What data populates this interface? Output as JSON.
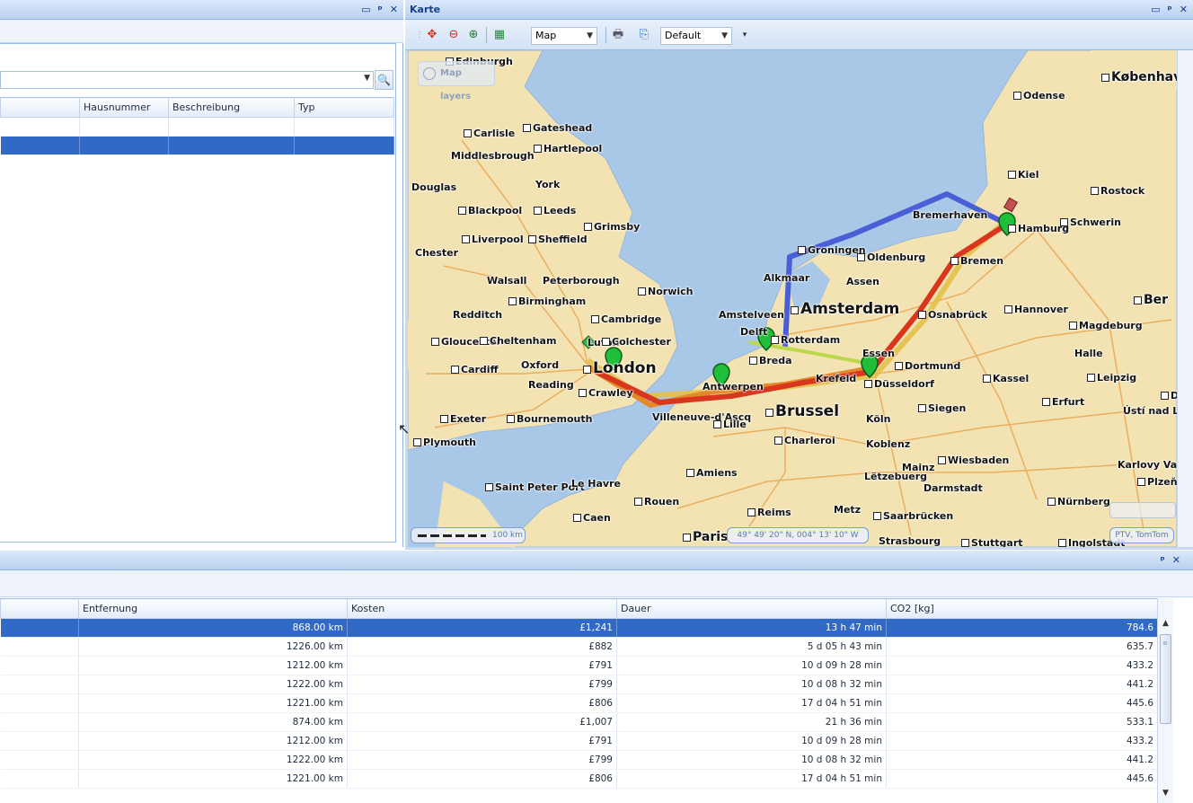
{
  "left_panel": {
    "window_buttons": [
      "▭",
      "ᵖ",
      "✕"
    ],
    "combo_value": "",
    "columns": [
      "",
      "Hausnummer",
      "Beschreibung",
      "Typ"
    ]
  },
  "map_panel": {
    "title": "Karte",
    "window_buttons": [
      "▭",
      "ᵖ",
      "✕"
    ],
    "toolbar": {
      "map_type_value": "Map",
      "profile_value": "Default"
    },
    "map_layers_label": "Map layers",
    "scale_label": "100 km",
    "coordinates": "49° 49' 20\" N, 004° 13' 10\" W",
    "copyright": "PTV, TomTom",
    "cities": [
      {
        "name": "Edinburgh",
        "size": "small"
      },
      {
        "name": "København",
        "size": "mid"
      },
      {
        "name": "Odense",
        "size": "small"
      },
      {
        "name": "Carlisle",
        "size": "small"
      },
      {
        "name": "Gateshead",
        "size": "small"
      },
      {
        "name": "Hartlepool",
        "size": "small"
      },
      {
        "name": "Middlesbrough",
        "size": "small"
      },
      {
        "name": "Kiel",
        "size": "small"
      },
      {
        "name": "Rostock",
        "size": "small"
      },
      {
        "name": "Douglas",
        "size": "small"
      },
      {
        "name": "York",
        "size": "small"
      },
      {
        "name": "Blackpool",
        "size": "small"
      },
      {
        "name": "Leeds",
        "size": "small"
      },
      {
        "name": "Bremerhaven",
        "size": "small"
      },
      {
        "name": "Grimsby",
        "size": "small"
      },
      {
        "name": "Hamburg",
        "size": "small"
      },
      {
        "name": "Schwerin",
        "size": "small"
      },
      {
        "name": "Liverpool",
        "size": "small"
      },
      {
        "name": "Sheffield",
        "size": "small"
      },
      {
        "name": "Chester",
        "size": "small"
      },
      {
        "name": "Groningen",
        "size": "small"
      },
      {
        "name": "Oldenburg",
        "size": "small"
      },
      {
        "name": "Bremen",
        "size": "small"
      },
      {
        "name": "Walsall",
        "size": "small"
      },
      {
        "name": "Peterborough",
        "size": "small"
      },
      {
        "name": "Alkmaar",
        "size": "small"
      },
      {
        "name": "Assen",
        "size": "small"
      },
      {
        "name": "Norwich",
        "size": "small"
      },
      {
        "name": "Birmingham",
        "size": "small"
      },
      {
        "name": "Ber",
        "size": "mid"
      },
      {
        "name": "Redditch",
        "size": "small"
      },
      {
        "name": "Cambridge",
        "size": "small"
      },
      {
        "name": "Amstelveen",
        "size": "small"
      },
      {
        "name": "Amsterdam",
        "size": "big"
      },
      {
        "name": "Osnabrück",
        "size": "small"
      },
      {
        "name": "Hannover",
        "size": "small"
      },
      {
        "name": "Magdeburg",
        "size": "small"
      },
      {
        "name": "Gloucester",
        "size": "small"
      },
      {
        "name": "Cheltenham",
        "size": "small"
      },
      {
        "name": "Luton",
        "size": "small"
      },
      {
        "name": "Colchester",
        "size": "small"
      },
      {
        "name": "Delft",
        "size": "small"
      },
      {
        "name": "Rotterdam",
        "size": "small"
      },
      {
        "name": "Essen",
        "size": "small"
      },
      {
        "name": "Halle",
        "size": "small"
      },
      {
        "name": "Oxford",
        "size": "small"
      },
      {
        "name": "London",
        "size": "big"
      },
      {
        "name": "Breda",
        "size": "small"
      },
      {
        "name": "Dortmund",
        "size": "small"
      },
      {
        "name": "Cardiff",
        "size": "small"
      },
      {
        "name": "Reading",
        "size": "small"
      },
      {
        "name": "Krefeld",
        "size": "small"
      },
      {
        "name": "Düsseldorf",
        "size": "small"
      },
      {
        "name": "Kassel",
        "size": "small"
      },
      {
        "name": "Leipzig",
        "size": "small"
      },
      {
        "name": "Crawley",
        "size": "small"
      },
      {
        "name": "Antwerpen",
        "size": "small"
      },
      {
        "name": "Erfurt",
        "size": "small"
      },
      {
        "name": "Dre",
        "size": "small"
      },
      {
        "name": "Brussel",
        "size": "big"
      },
      {
        "name": "Siegen",
        "size": "small"
      },
      {
        "name": "Exeter",
        "size": "small"
      },
      {
        "name": "Bournemouth",
        "size": "small"
      },
      {
        "name": "Villeneuve-d'Ascq",
        "size": "small"
      },
      {
        "name": "Lille",
        "size": "small"
      },
      {
        "name": "Köln",
        "size": "small"
      },
      {
        "name": "Ústí nad Labem",
        "size": "small"
      },
      {
        "name": "Plymouth",
        "size": "small"
      },
      {
        "name": "Charleroi",
        "size": "small"
      },
      {
        "name": "Koblenz",
        "size": "small"
      },
      {
        "name": "Wiesbaden",
        "size": "small"
      },
      {
        "name": "Mainz",
        "size": "small"
      },
      {
        "name": "Karlovy Vary",
        "size": "small"
      },
      {
        "name": "Amiens",
        "size": "small"
      },
      {
        "name": "Lëtzebuerg",
        "size": "small"
      },
      {
        "name": "Plzeň",
        "size": "small"
      },
      {
        "name": "Saint Peter Port",
        "size": "small"
      },
      {
        "name": "Le Havre",
        "size": "small"
      },
      {
        "name": "Darmstadt",
        "size": "small"
      },
      {
        "name": "Rouen",
        "size": "small"
      },
      {
        "name": "Nürnberg",
        "size": "small"
      },
      {
        "name": "Reims",
        "size": "small"
      },
      {
        "name": "Metz",
        "size": "small"
      },
      {
        "name": "Caen",
        "size": "small"
      },
      {
        "name": "Saarbrücken",
        "size": "small"
      },
      {
        "name": "Paris",
        "size": "mid"
      },
      {
        "name": "Strasbourg",
        "size": "small"
      },
      {
        "name": "Stuttgart",
        "size": "small"
      },
      {
        "name": "Ingolstadt",
        "size": "small"
      }
    ]
  },
  "bottom_panel": {
    "window_buttons": [
      "ᵖ",
      "✕"
    ],
    "columns": [
      "",
      "Entfernung",
      "Kosten",
      "Dauer",
      "CO2 [kg]"
    ],
    "rows": [
      {
        "distance": "868.00 km",
        "cost": "£1,241",
        "duration": "13 h 47 min",
        "co2": "784.6"
      },
      {
        "distance": "1226.00 km",
        "cost": "£882",
        "duration": "5 d 05 h 43 min",
        "co2": "635.7"
      },
      {
        "distance": "1212.00 km",
        "cost": "£791",
        "duration": "10 d 09 h 28 min",
        "co2": "433.2"
      },
      {
        "distance": "1222.00 km",
        "cost": "£799",
        "duration": "10 d 08 h 32 min",
        "co2": "441.2"
      },
      {
        "distance": "1221.00 km",
        "cost": "£806",
        "duration": "17 d 04 h 51 min",
        "co2": "445.6"
      },
      {
        "distance": "874.00 km",
        "cost": "£1,007",
        "duration": "21 h 36 min",
        "co2": "533.1"
      },
      {
        "distance": "1212.00 km",
        "cost": "£791",
        "duration": "10 d 09 h 28 min",
        "co2": "433.2"
      },
      {
        "distance": "1222.00 km",
        "cost": "£799",
        "duration": "10 d 08 h 32 min",
        "co2": "441.2"
      },
      {
        "distance": "1221.00 km",
        "cost": "£806",
        "duration": "17 d 04 h 51 min",
        "co2": "445.6"
      }
    ]
  },
  "colors": {
    "selection": "#3169c6",
    "route_blue": "#4a5fd6",
    "route_red": "#d9361e",
    "route_orange": "#e28a2a",
    "route_yellow": "#e3c04b",
    "marker_green": "#1fbf3a",
    "sea": "#a9c8e8",
    "land": "#f3e3b3"
  }
}
